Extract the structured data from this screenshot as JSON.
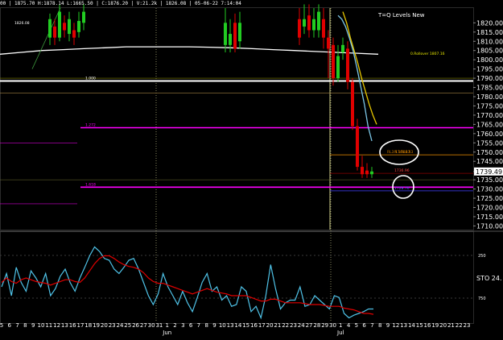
{
  "header": {
    "text": "00 | 1875.70 H:1878.14 L:1665.50 | C:1876.20 | V:21.2k | 1826.08 | 05-06-22 7:14:04"
  },
  "chart_data": [
    {
      "type": "line",
      "title": "T=Q Levels New",
      "ylim": [
        1708,
        1828
      ],
      "y_ticks": [
        "1820.00",
        "1815.00",
        "1810.00",
        "1805.00",
        "1800.00",
        "1795.00",
        "1790.00",
        "1785.00",
        "1780.00",
        "1775.00",
        "1770.00",
        "1765.00",
        "1760.00",
        "1755.00",
        "1750.00",
        "1745.00",
        "1739.49",
        "1735.00",
        "1730.00",
        "1725.00",
        "1720.00",
        "1715.00",
        "1710.00"
      ],
      "last_price": "1739.49",
      "price_tag_color": "#ffffff",
      "levels": [
        {
          "y": 1788.5,
          "color": "#ffffff",
          "label": "1.000"
        },
        {
          "y": 1763.2,
          "color": "#ff00ff",
          "label": "1.272"
        },
        {
          "y": 1731.0,
          "color": "#ff00ff",
          "label": "1.618"
        },
        {
          "y": 1748.5,
          "color": "#cc7a00",
          "label": "N 1748.83"
        },
        {
          "y": 1738.5,
          "color": "#8b0000",
          "label": "1736.96"
        },
        {
          "y": 1729.0,
          "color": "#4040ff",
          "label": "1728.76"
        }
      ],
      "annotations": [
        "0.Rollover 1807.16",
        "1826.08",
        "RL3 1748.87"
      ],
      "series": [
        {
          "color": "#ffffff",
          "values": [
            1803,
            1804,
            1805,
            1805.5,
            1806,
            1806.5,
            1807,
            1807,
            1807,
            1807,
            1806.8,
            1806.5,
            1806,
            1805.5,
            1805,
            1804.5,
            1804,
            1803.5,
            1803
          ]
        },
        {
          "color": "#7cc7e8",
          "values": [
            1824,
            1822,
            1818,
            1812,
            1805,
            1796,
            1786,
            1776,
            1764,
            1756
          ]
        },
        {
          "color": "#e8c800",
          "values": [
            1826,
            1820,
            1812,
            1805,
            1798,
            1790,
            1783,
            1776,
            1770,
            1765
          ]
        }
      ],
      "candles": [
        {
          "x": 62,
          "o": 1812,
          "c": 1822,
          "h": 1825,
          "l": 1808
        },
        {
          "x": 68,
          "o": 1818,
          "c": 1812,
          "h": 1822,
          "l": 1808
        },
        {
          "x": 74,
          "o": 1812,
          "c": 1826,
          "h": 1830,
          "l": 1810
        },
        {
          "x": 80,
          "o": 1820,
          "c": 1816,
          "h": 1824,
          "l": 1812
        },
        {
          "x": 86,
          "o": 1814,
          "c": 1822,
          "h": 1826,
          "l": 1810
        },
        {
          "x": 92,
          "o": 1816,
          "c": 1812,
          "h": 1820,
          "l": 1808
        },
        {
          "x": 98,
          "o": 1815,
          "c": 1821,
          "h": 1826,
          "l": 1812
        },
        {
          "x": 104,
          "o": 1820,
          "c": 1826,
          "h": 1830,
          "l": 1816
        },
        {
          "x": 280,
          "o": 1808,
          "c": 1820,
          "h": 1828,
          "l": 1804
        },
        {
          "x": 286,
          "o": 1808,
          "c": 1814,
          "h": 1822,
          "l": 1804
        },
        {
          "x": 292,
          "o": 1820,
          "c": 1806,
          "h": 1825,
          "l": 1804
        },
        {
          "x": 298,
          "o": 1810,
          "c": 1820,
          "h": 1826,
          "l": 1806
        },
        {
          "x": 372,
          "o": 1822,
          "c": 1812,
          "h": 1828,
          "l": 1808
        },
        {
          "x": 378,
          "o": 1818,
          "c": 1822,
          "h": 1830,
          "l": 1814
        },
        {
          "x": 384,
          "o": 1824,
          "c": 1816,
          "h": 1830,
          "l": 1812
        },
        {
          "x": 390,
          "o": 1816,
          "c": 1822,
          "h": 1828,
          "l": 1812
        },
        {
          "x": 396,
          "o": 1816,
          "c": 1826,
          "h": 1830,
          "l": 1812
        },
        {
          "x": 402,
          "o": 1822,
          "c": 1812,
          "h": 1828,
          "l": 1806
        },
        {
          "x": 408,
          "o": 1812,
          "c": 1806,
          "h": 1816,
          "l": 1790
        },
        {
          "x": 414,
          "o": 1808,
          "c": 1790,
          "h": 1812,
          "l": 1786
        },
        {
          "x": 420,
          "o": 1790,
          "c": 1802,
          "h": 1808,
          "l": 1788
        },
        {
          "x": 426,
          "o": 1804,
          "c": 1808,
          "h": 1812,
          "l": 1800
        },
        {
          "x": 432,
          "o": 1806,
          "c": 1788,
          "h": 1810,
          "l": 1784
        },
        {
          "x": 438,
          "o": 1788,
          "c": 1764,
          "h": 1790,
          "l": 1762
        },
        {
          "x": 444,
          "o": 1764,
          "c": 1742,
          "h": 1768,
          "l": 1740
        },
        {
          "x": 450,
          "o": 1742,
          "c": 1738,
          "h": 1748,
          "l": 1736
        },
        {
          "x": 456,
          "o": 1740,
          "c": 1738,
          "h": 1744,
          "l": 1736
        },
        {
          "x": 462,
          "o": 1738,
          "c": 1739.5,
          "h": 1742,
          "l": 1736
        }
      ]
    },
    {
      "type": "line",
      "title": "STO",
      "label_value": "24.",
      "ylim": [
        0,
        100
      ],
      "y_ticks": [
        "250",
        "750"
      ],
      "series": [
        {
          "name": "",
          "color": "#4fc3e8",
          "values": [
            40,
            55,
            30,
            62,
            45,
            35,
            58,
            50,
            40,
            55,
            30,
            38,
            52,
            60,
            45,
            35,
            50,
            62,
            75,
            85,
            80,
            72,
            70,
            60,
            55,
            62,
            70,
            72,
            60,
            45,
            30,
            20,
            32,
            55,
            40,
            30,
            20,
            35,
            22,
            12,
            28,
            45,
            55,
            35,
            40,
            25,
            30,
            18,
            20,
            40,
            35,
            12,
            18,
            5,
            30,
            65,
            38,
            15,
            22,
            25,
            25,
            40,
            18,
            20,
            30,
            25,
            20,
            15,
            30,
            28,
            10,
            5,
            8,
            10,
            12,
            15,
            15
          ]
        },
        {
          "name": "",
          "color": "#e00000",
          "values": [
            45,
            50,
            46,
            44,
            48,
            50,
            48,
            46,
            45,
            44,
            42,
            44,
            46,
            48,
            48,
            46,
            45,
            50,
            58,
            66,
            72,
            75,
            75,
            72,
            68,
            65,
            63,
            62,
            60,
            56,
            50,
            46,
            44,
            44,
            42,
            40,
            38,
            36,
            34,
            32,
            34,
            36,
            38,
            36,
            34,
            33,
            32,
            30,
            30,
            30,
            30,
            28,
            26,
            24,
            24,
            26,
            26,
            24,
            22,
            22,
            22,
            22,
            21,
            20,
            20,
            20,
            19,
            18,
            18,
            18,
            16,
            15,
            14,
            12,
            10,
            10,
            9
          ]
        }
      ]
    }
  ],
  "x_axis": {
    "days": [
      "5",
      "6",
      "7",
      "8",
      "9",
      "10",
      "11",
      "12",
      "13",
      "16",
      "17",
      "18",
      "19",
      "20",
      "23",
      "24",
      "25",
      "26",
      "27",
      "30",
      "31",
      "1",
      "2",
      "3",
      "6",
      "7",
      "8",
      "9",
      "10",
      "13",
      "14",
      "15",
      "16",
      "17",
      "20",
      "21",
      "22",
      "23",
      "24",
      "27",
      "28",
      "29",
      "30",
      "1",
      "4",
      "5",
      "6",
      "7",
      "8",
      "9",
      "12",
      "13",
      "14",
      "15",
      "16",
      "19",
      "20",
      "21",
      "22",
      "23"
    ],
    "months": [
      {
        "label": "Jun",
        "day_index": 21
      },
      {
        "label": "Jul",
        "day_index": 43
      }
    ]
  }
}
